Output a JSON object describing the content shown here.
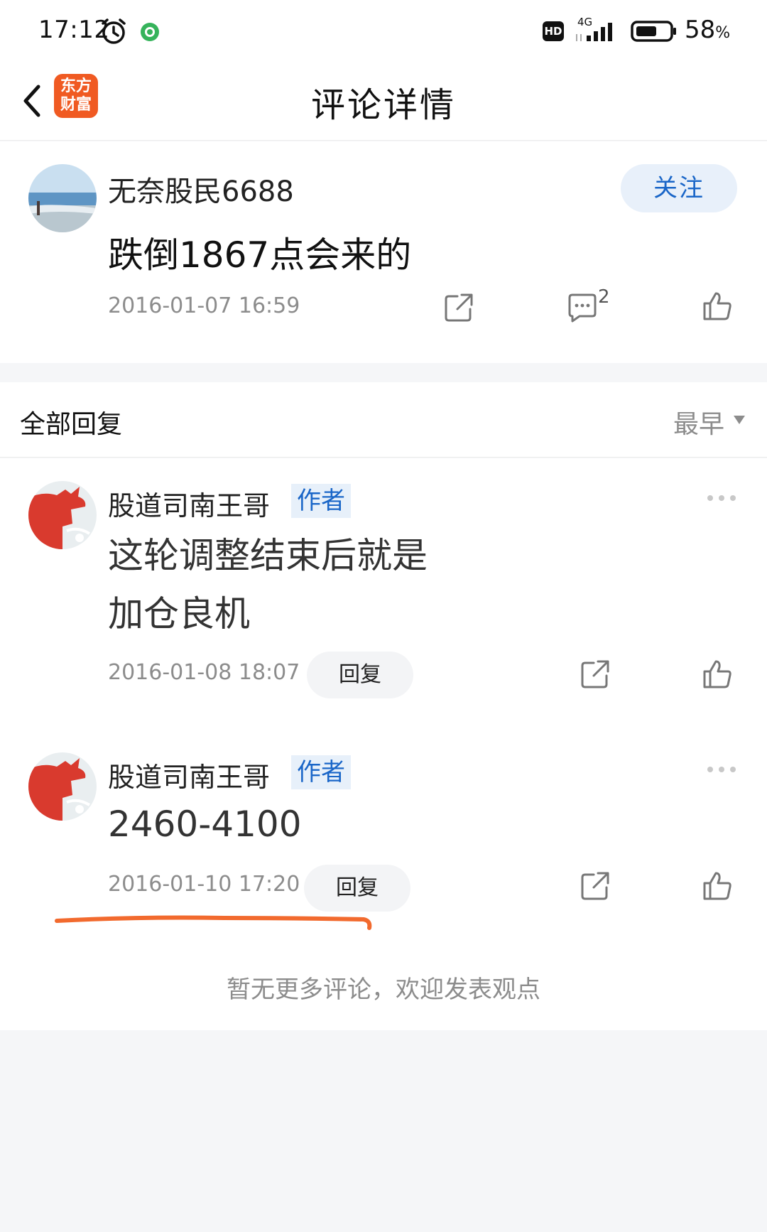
{
  "status_bar": {
    "time": "17:12",
    "network": "4G",
    "hd_label": "HD",
    "battery_percent": "58",
    "battery_unit": "%"
  },
  "nav": {
    "logo_line1": "东方",
    "logo_line2": "财富",
    "title": "评论详情"
  },
  "post": {
    "author": "无奈股民6688",
    "follow_label": "关注",
    "content": "跌倒1867点会来的",
    "time": "2016-01-07 16:59",
    "comment_count": "2"
  },
  "replies_header": {
    "title": "全部回复",
    "sort_label": "最早"
  },
  "replies": [
    {
      "author": "股道司南王哥",
      "badge": "作者",
      "content": "这轮调整结束后就是加仓良机",
      "time": "2016-01-08 18:07",
      "reply_label": "回复"
    },
    {
      "author": "股道司南王哥",
      "badge": "作者",
      "content": "2460-4100",
      "time": "2016-01-10 17:20",
      "reply_label": "回复"
    }
  ],
  "footer": {
    "no_more": "暂无更多评论，欢迎发表观点"
  },
  "colors": {
    "accent_blue": "#1a66c8",
    "brand_orange": "#f05a22",
    "annotation_orange": "#f26a2e"
  },
  "icons": [
    "alarm-icon",
    "app-green-icon",
    "signal-icon",
    "battery-icon",
    "back-icon",
    "share-icon",
    "comment-icon",
    "like-icon",
    "more-icon",
    "sort-arrow-icon"
  ]
}
